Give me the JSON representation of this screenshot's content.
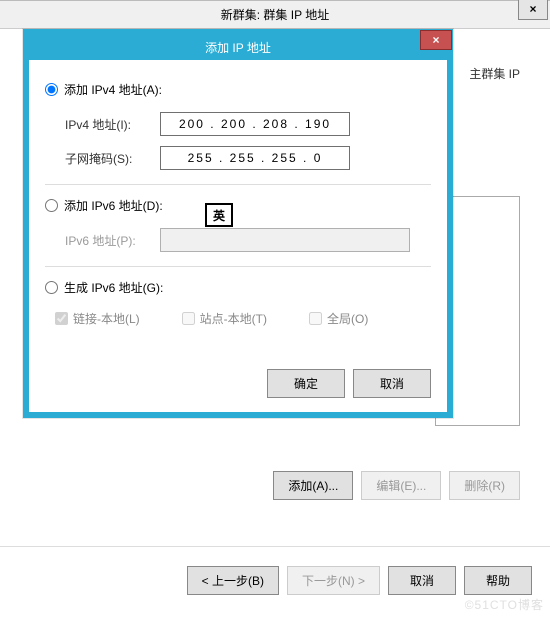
{
  "parent": {
    "title": "新群集: 群集 IP 地址",
    "close": "×",
    "side_text": "主群集 IP",
    "buttons": {
      "add": "添加(A)...",
      "edit": "编辑(E)...",
      "remove": "删除(R)"
    },
    "bottom": {
      "back": "< 上一步(B)",
      "next": "下一步(N) >",
      "cancel": "取消",
      "help": "帮助"
    }
  },
  "modal": {
    "title": "添加 IP 地址",
    "close": "×",
    "ipv4": {
      "radio_label": "添加 IPv4 地址(A):",
      "addr_label": "IPv4 地址(I):",
      "addr_value": "200 . 200 . 208 . 190",
      "mask_label": "子网掩码(S):",
      "mask_value": "255 . 255 . 255 .  0"
    },
    "ime_badge": "英",
    "ipv6": {
      "radio_label": "添加 IPv6 地址(D):",
      "addr_label": "IPv6 地址(P):"
    },
    "gen": {
      "radio_label": "生成 IPv6 地址(G):",
      "link_local": "链接-本地(L)",
      "site_local": "站点-本地(T)",
      "global": "全局(O)"
    },
    "footer": {
      "ok": "确定",
      "cancel": "取消"
    }
  },
  "watermark": "©51CTO博客"
}
